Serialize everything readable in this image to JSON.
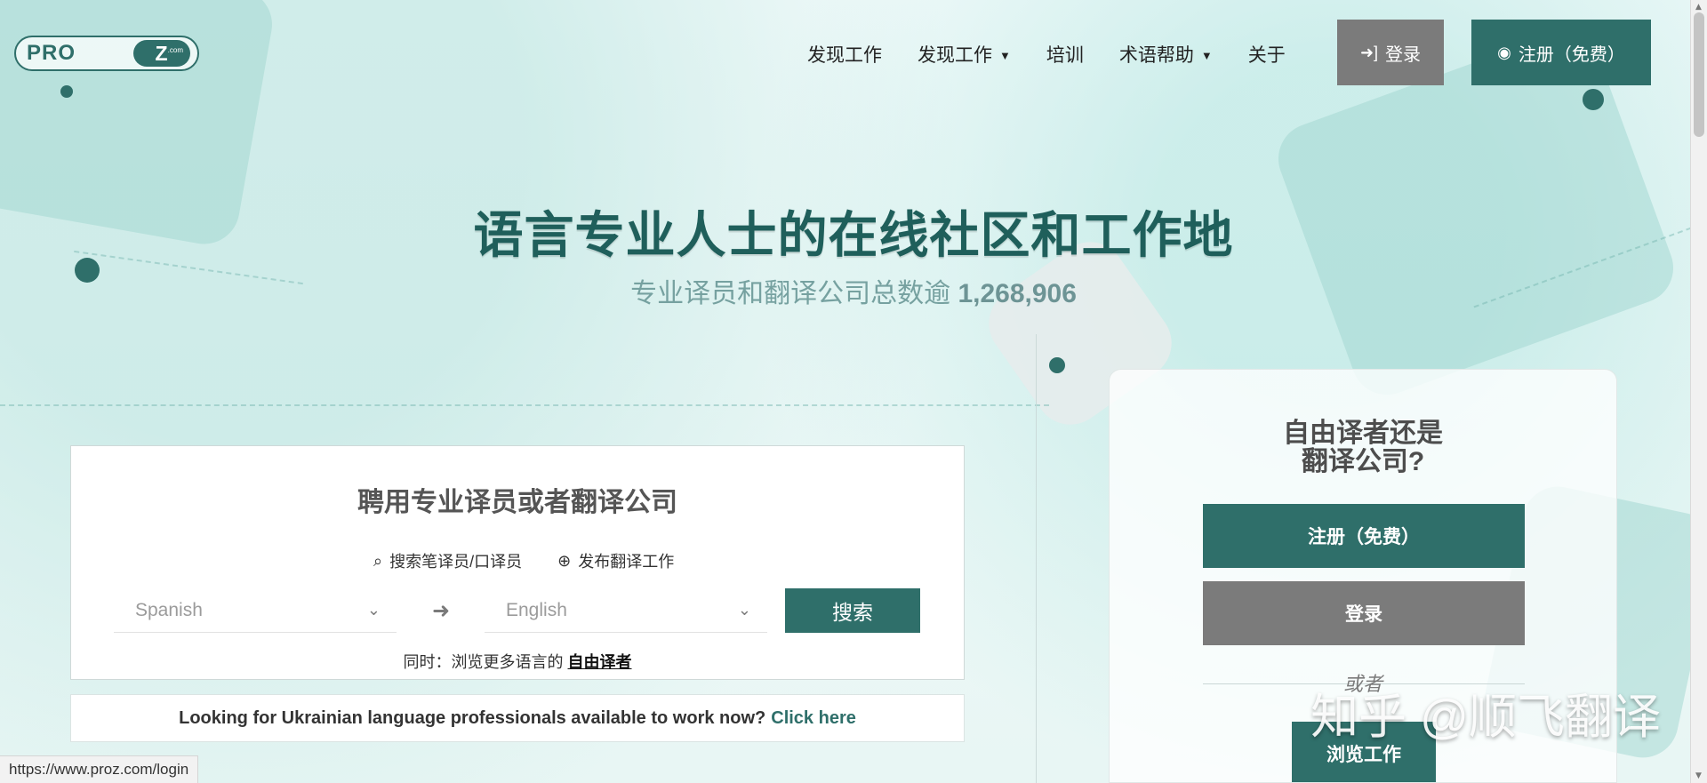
{
  "brand": {
    "logo_left": "PRO",
    "logo_z": "Z",
    "logo_suffix": ".com"
  },
  "nav": {
    "items": [
      {
        "label": "发现工作",
        "has_dropdown": false
      },
      {
        "label": "发现工作",
        "has_dropdown": true
      },
      {
        "label": "培训",
        "has_dropdown": false
      },
      {
        "label": "术语帮助",
        "has_dropdown": true
      },
      {
        "label": "关于",
        "has_dropdown": false
      }
    ],
    "login_label": "登录",
    "register_label": "注册（免费）",
    "login_icon": "sign-in-icon",
    "register_icon": "user-circle-icon"
  },
  "hero": {
    "title": "语言专业人士的在线社区和工作地",
    "subtitle_prefix": "专业译员和翻译公司总数逾",
    "subtitle_count": "1,268,906"
  },
  "hire_card": {
    "title": "聘用专业译员或者翻译公司",
    "search_link": "搜索笔译员/口译员",
    "post_job_link": "发布翻译工作",
    "source_language": "Spanish",
    "target_language": "English",
    "search_button": "搜索",
    "browse_prefix": "同时：浏览更多语言的",
    "browse_link": "自由译者"
  },
  "ukraine_notice": {
    "text": "Looking for Ukrainian language professionals available to work now?",
    "link": "Click here"
  },
  "right_panel": {
    "title_line1": "自由译者还是",
    "title_line2": "翻译公司?",
    "register_button": "注册（免费）",
    "login_button": "登录",
    "or_text": "或者",
    "browse_jobs_button": "浏览工作"
  },
  "watermark": {
    "text": "知乎 @顺飞翻译"
  },
  "status_bar": {
    "url": "https://www.proz.com/login"
  },
  "colors": {
    "brand": "#2f6f6a",
    "gray_button": "#7b7b7b",
    "title": "#1f5f5b"
  }
}
